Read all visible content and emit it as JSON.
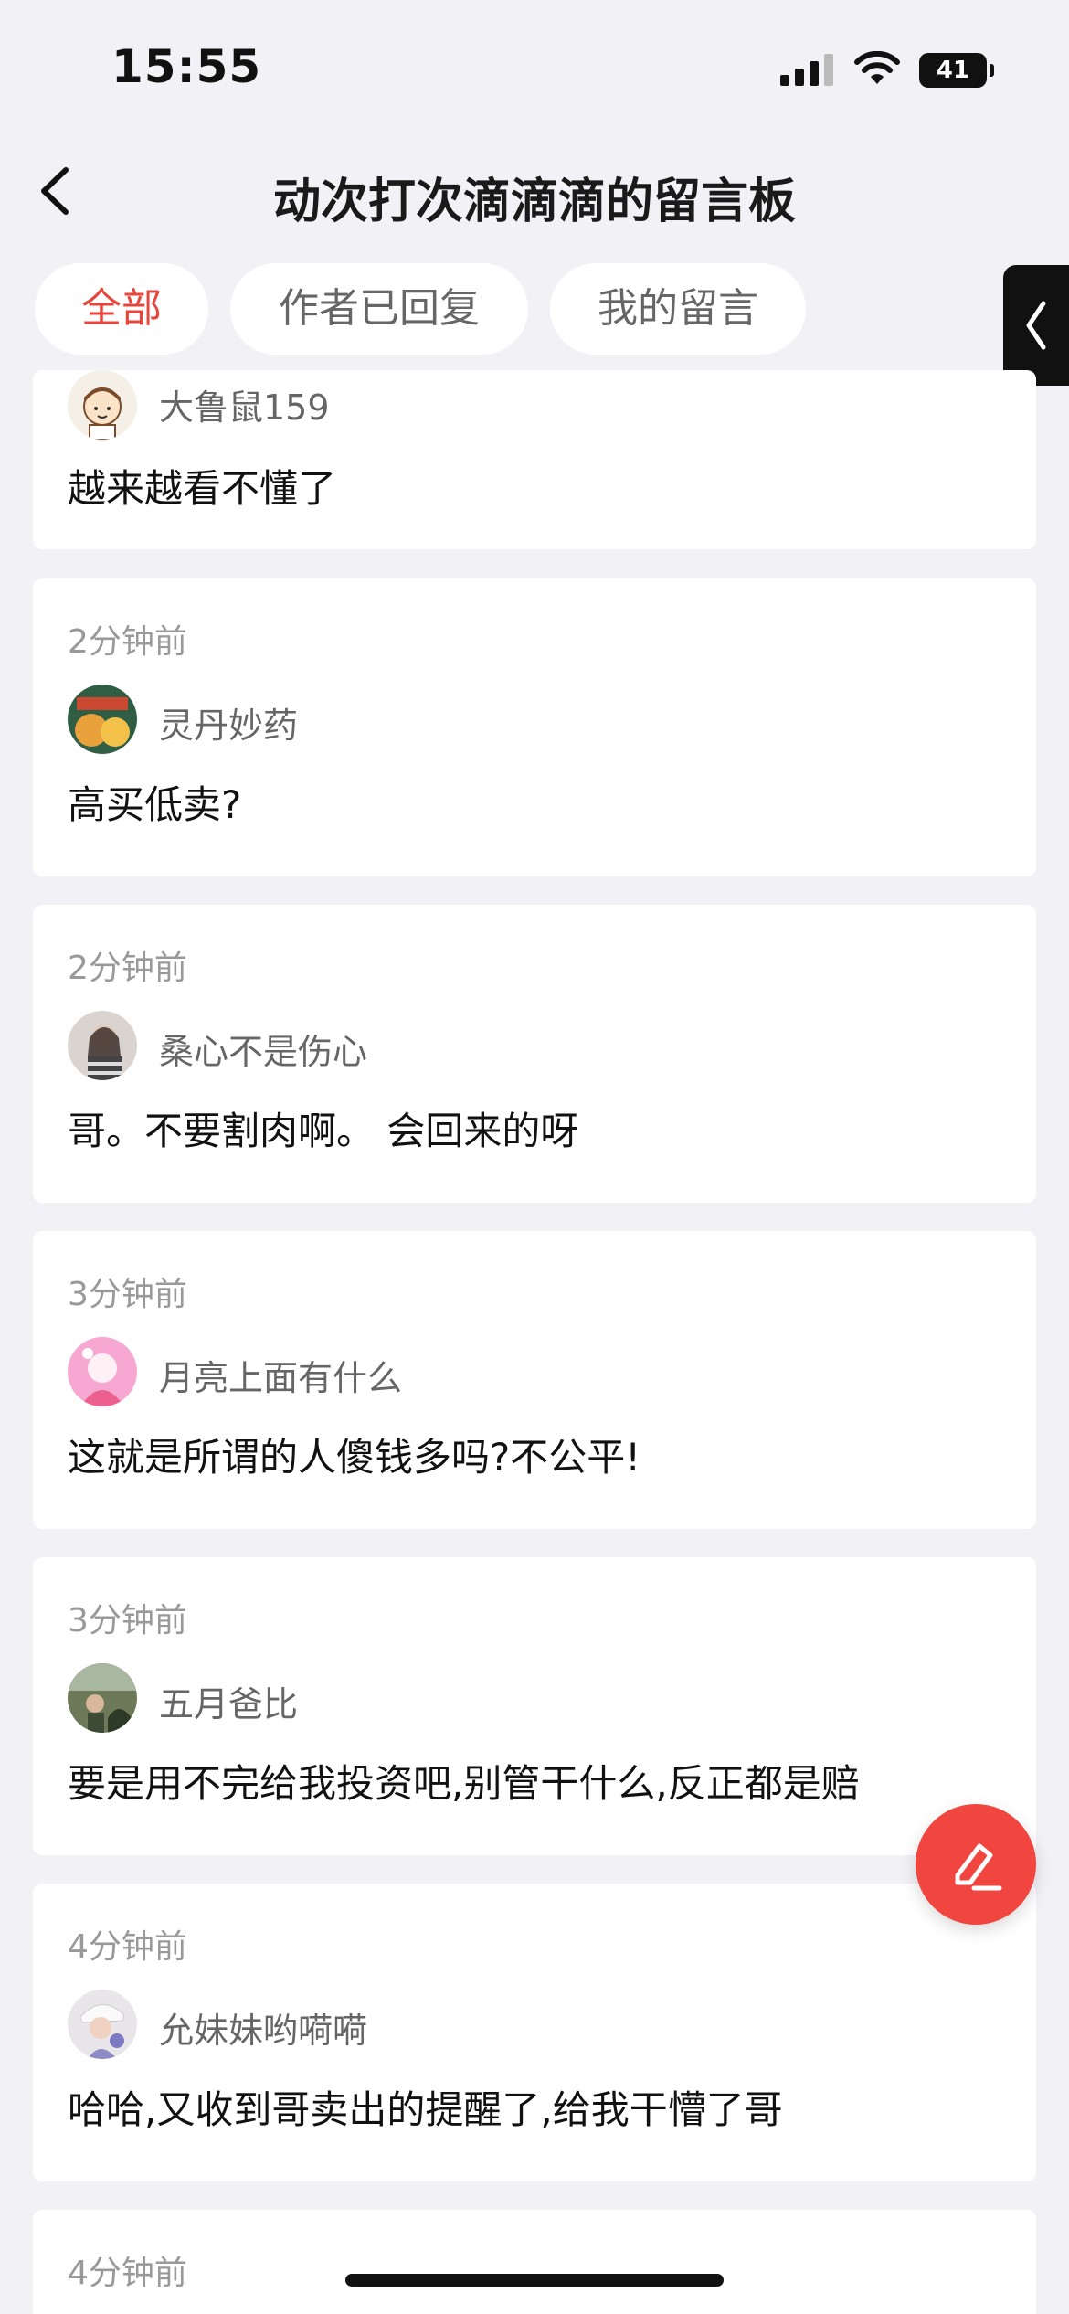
{
  "status_bar": {
    "time": "15:55",
    "battery": "41"
  },
  "nav": {
    "title": "动次打次滴滴滴的留言板"
  },
  "tabs": [
    {
      "label": "全部",
      "active": true
    },
    {
      "label": "作者已回复",
      "active": false
    },
    {
      "label": "我的留言",
      "active": false
    }
  ],
  "comments": [
    {
      "time": "",
      "user": "大鲁鼠159",
      "text": "越来越看不懂了"
    },
    {
      "time": "2分钟前",
      "user": "灵丹妙药",
      "text": "高买低卖?"
    },
    {
      "time": "2分钟前",
      "user": "桑心不是伤心",
      "text": "哥。不要割肉啊。 会回来的呀"
    },
    {
      "time": "3分钟前",
      "user": "月亮上面有什么",
      "text": "这就是所谓的人傻钱多吗?不公平!"
    },
    {
      "time": "3分钟前",
      "user": "五月爸比",
      "text": "要是用不完给我投资吧,别管干什么,反正都是赔"
    },
    {
      "time": "4分钟前",
      "user": "允妹妹哟嗬嗬",
      "text": "哈哈,又收到哥卖出的提醒了,给我干懵了哥"
    },
    {
      "time": "4分钟前",
      "user": "",
      "text": ""
    }
  ],
  "colors": {
    "accent": "#f0463f",
    "active_tab": "#e8453c",
    "background": "#f2f2f6"
  },
  "icons": {
    "back": "chevron-left-icon",
    "side_handle": "chevron-left-icon",
    "fab": "compose-icon",
    "signal": "signal-bars-icon",
    "wifi": "wifi-icon",
    "battery": "battery-icon"
  }
}
